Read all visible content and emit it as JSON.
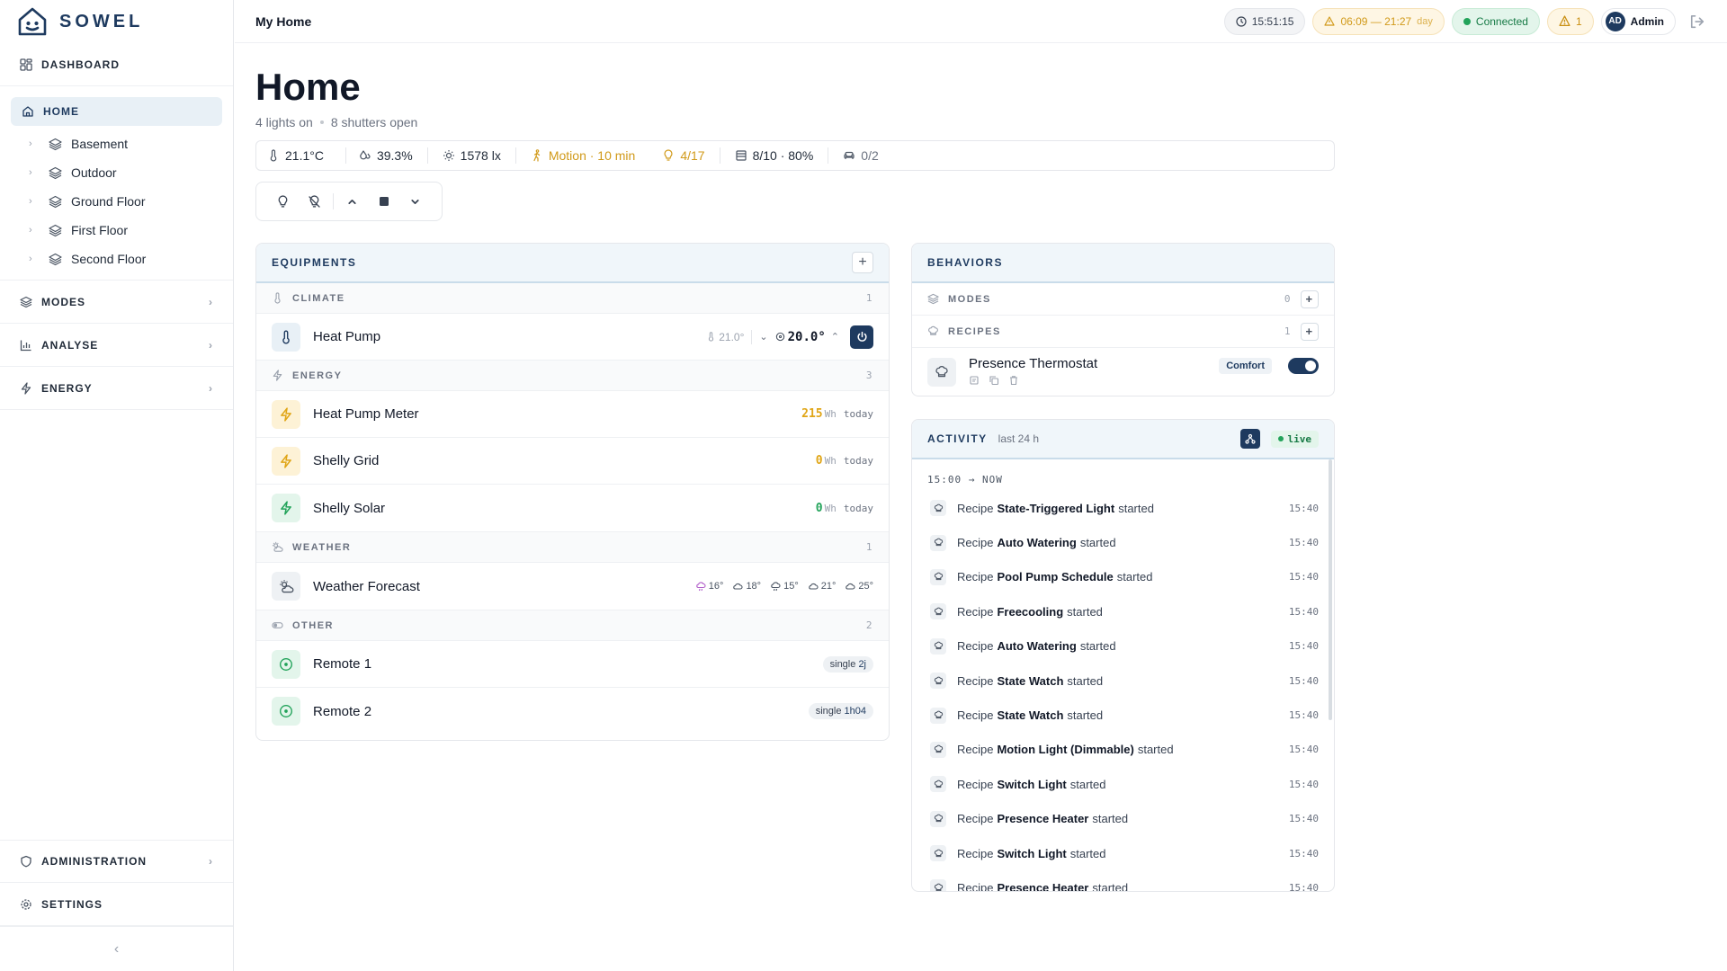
{
  "app": {
    "name": "SOWEL"
  },
  "header": {
    "title": "My Home",
    "time": "15:51:15",
    "sun": "06:09 — 21:27",
    "sun_phase": "day",
    "status": "Connected",
    "alerts": "1",
    "user_initials": "AD",
    "user_name": "Admin"
  },
  "sidebar": {
    "dashboard": "DASHBOARD",
    "home": "HOME",
    "floors": [
      "Basement",
      "Outdoor",
      "Ground Floor",
      "First Floor",
      "Second Floor"
    ],
    "modes": "MODES",
    "analyse": "ANALYSE",
    "energy": "ENERGY",
    "administration": "ADMINISTRATION",
    "settings": "SETTINGS"
  },
  "page": {
    "title": "Home",
    "lights_on": "4 lights on",
    "shutters_open": "8 shutters open"
  },
  "stats": {
    "temperature": "21.1°C",
    "humidity": "39.3%",
    "luminosity": "1578 lx",
    "motion": "Motion · 10 min",
    "lights": "4/17",
    "shutters": "8/10 · 80%",
    "presence": "0/2"
  },
  "equipments": {
    "title": "EQUIPMENTS",
    "climate": {
      "label": "CLIMATE",
      "count": "1",
      "heat_pump": {
        "name": "Heat Pump",
        "current": "21.0°",
        "setpoint": "20.0°"
      }
    },
    "energy": {
      "label": "ENERGY",
      "count": "3",
      "items": [
        {
          "name": "Heat Pump Meter",
          "value": "215",
          "unit": "Wh",
          "suffix": "today",
          "color": "#e0a516"
        },
        {
          "name": "Shelly Grid",
          "value": "0",
          "unit": "Wh",
          "suffix": "today",
          "color": "#e0a516"
        },
        {
          "name": "Shelly Solar",
          "value": "0",
          "unit": "Wh",
          "suffix": "today",
          "color": "#22a35a"
        }
      ]
    },
    "weather": {
      "label": "WEATHER",
      "count": "1",
      "forecast": {
        "name": "Weather Forecast",
        "temps": [
          "16°",
          "18°",
          "15°",
          "21°",
          "25°"
        ]
      }
    },
    "other": {
      "label": "OTHER",
      "count": "2",
      "items": [
        {
          "name": "Remote 1",
          "action": "single",
          "ago": "2j"
        },
        {
          "name": "Remote 2",
          "action": "single",
          "ago": "1h04"
        }
      ]
    }
  },
  "behaviors": {
    "title": "BEHAVIORS",
    "modes_label": "MODES",
    "modes_count": "0",
    "recipes_label": "RECIPES",
    "recipes_count": "1",
    "recipe": {
      "name": "Presence Thermostat",
      "mode": "Comfort"
    }
  },
  "activity": {
    "title": "ACTIVITY",
    "range": "last 24 h",
    "live": "live",
    "period": "15:00 → NOW",
    "prefix": "Recipe",
    "suffix": "started",
    "items": [
      {
        "name": "State-Triggered Light",
        "time": "15:40"
      },
      {
        "name": "Auto Watering",
        "time": "15:40"
      },
      {
        "name": "Pool Pump Schedule",
        "time": "15:40"
      },
      {
        "name": "Freecooling",
        "time": "15:40"
      },
      {
        "name": "Auto Watering",
        "time": "15:40"
      },
      {
        "name": "State Watch",
        "time": "15:40"
      },
      {
        "name": "State Watch",
        "time": "15:40"
      },
      {
        "name": "Motion Light (Dimmable)",
        "time": "15:40"
      },
      {
        "name": "Switch Light",
        "time": "15:40"
      },
      {
        "name": "Presence Heater",
        "time": "15:40"
      },
      {
        "name": "Switch Light",
        "time": "15:40"
      },
      {
        "name": "Presence Heater",
        "time": "15:40"
      }
    ]
  }
}
